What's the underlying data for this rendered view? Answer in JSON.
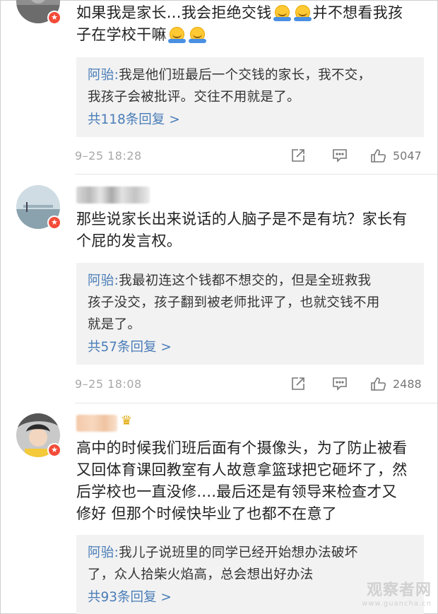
{
  "comments": [
    {
      "text_parts": [
        "如果我是家长...我会拒绝交钱",
        "并不想看我孩",
        "子在学校干嘛"
      ],
      "reply": {
        "author": "阿骀:",
        "lines": [
          "我是他们班最后一个交钱的家长，我不交，",
          "我孩子会被批评。交往不用就是了。"
        ],
        "more": "共118条回复 >"
      },
      "time": "9–25 18:28",
      "likes": "5047"
    },
    {
      "lines": [
        "那些说家长出来说话的人脑子是不是有坑？家长有",
        "个屁的发言权。"
      ],
      "reply": {
        "author": "阿骀:",
        "lines": [
          "我最初连这个钱都不想交的，但是全班救我",
          "孩子没交，孩子翻到被老师批评了，也就交钱不用",
          "就是了。"
        ],
        "more": "共57条回复 >"
      },
      "time": "9–25 18:08",
      "likes": "2488"
    },
    {
      "lines": [
        "高中的时候我们班后面有个摄像头，为了防止被看",
        "又回体育课回教室有人故意拿篮球把它砸坏了，然",
        "后学校也一直没修....最后还是有领导来检查才又",
        "修好 但那个时候快毕业了也都不在意了"
      ],
      "reply": {
        "author": "阿骀:",
        "lines": [
          "我儿子说班里的同学已经开始想办法破坏",
          "了，众人拾柴火焰高，总会想出好办法"
        ],
        "more": "共93条回复 >"
      }
    }
  ],
  "watermark": {
    "cn": "观察者网",
    "en": "www.guancha.cn"
  },
  "icons": [
    "share-icon",
    "comment-icon",
    "like-icon",
    "verified-badge-icon",
    "crown-icon",
    "emoji-icon"
  ]
}
